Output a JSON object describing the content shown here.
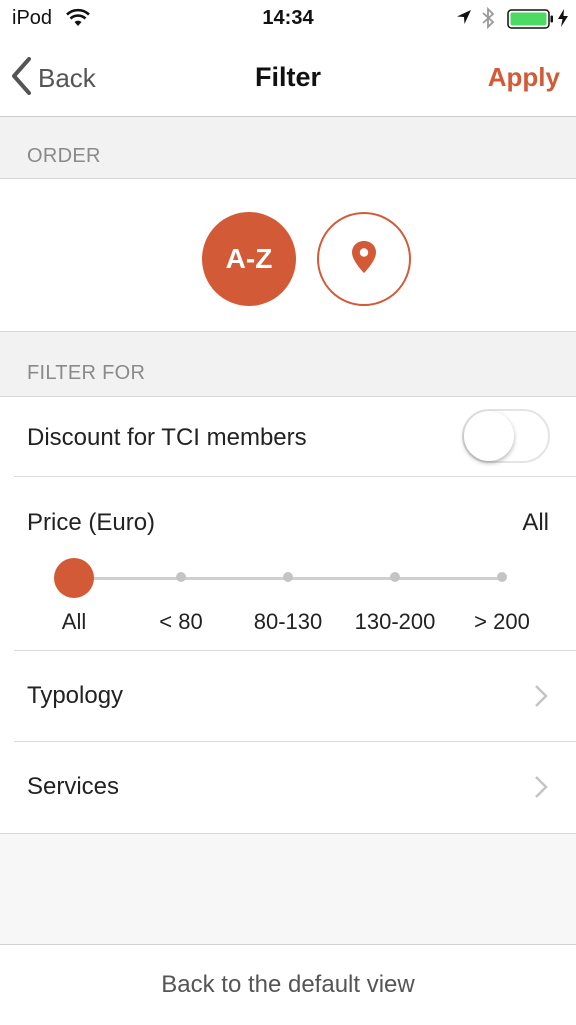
{
  "status_bar": {
    "carrier": "iPod",
    "time": "14:34",
    "battery_color": "#4cd964"
  },
  "nav": {
    "back_label": "Back",
    "title": "Filter",
    "apply_label": "Apply"
  },
  "accent_color": "#d35a37",
  "order": {
    "header": "ORDER",
    "az_label": "A-Z",
    "selected": "A-Z",
    "location_icon": "map-pin-icon"
  },
  "filter": {
    "header": "FILTER FOR",
    "discount": {
      "label": "Discount for TCI members",
      "enabled": false
    },
    "price": {
      "label": "Price (Euro)",
      "value": "All",
      "options": [
        "All",
        "< 80",
        "80-130",
        "130-200",
        "> 200"
      ],
      "selected_index": 0
    },
    "typology_label": "Typology",
    "services_label": "Services"
  },
  "footer": {
    "reset_label": "Back to the default view"
  }
}
